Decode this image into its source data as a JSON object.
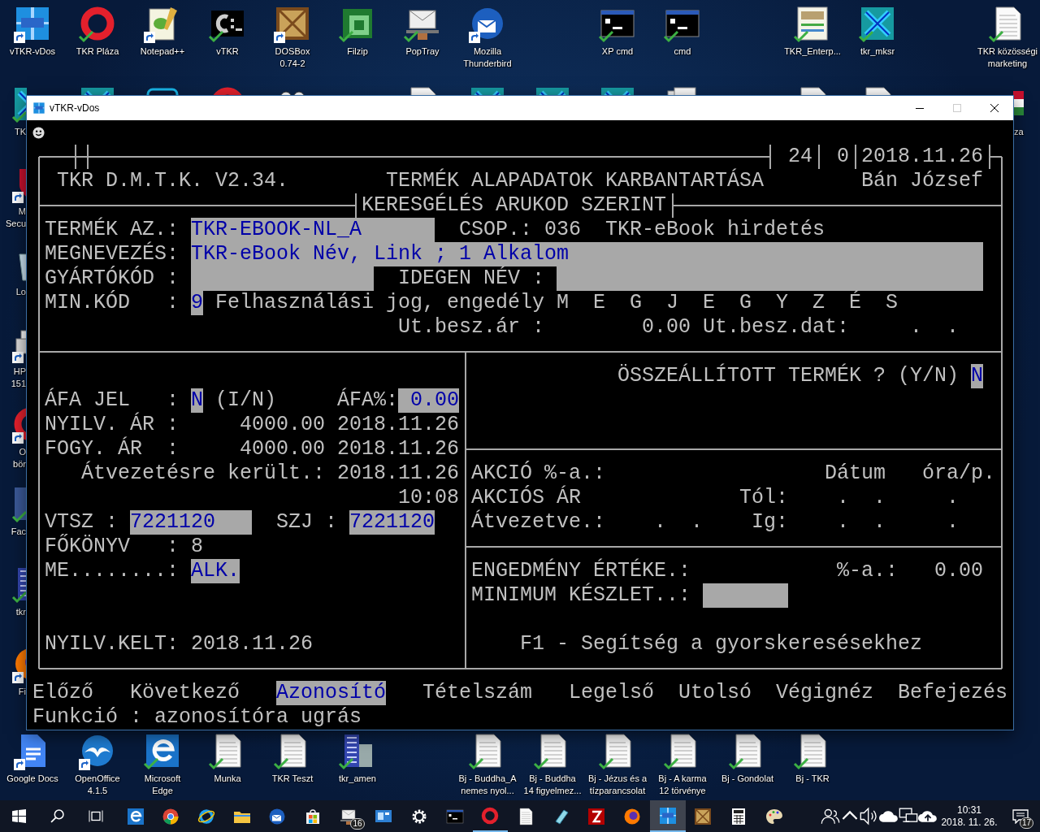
{
  "top_row_icons": [
    {
      "label": "vTKR-vDos",
      "kind": "dos",
      "shortcut": true,
      "synced": false
    },
    {
      "label": "TKR Pláza",
      "kind": "opera",
      "shortcut": false,
      "synced": true
    },
    {
      "label": "Notepad++",
      "kind": "notepad",
      "shortcut": true,
      "synced": false
    },
    {
      "label": "vTKR",
      "kind": "console",
      "shortcut": false,
      "synced": true
    },
    {
      "label": "DOSBox\n0.74-2",
      "kind": "dosbox",
      "shortcut": true,
      "synced": false
    },
    {
      "label": "Filzip",
      "kind": "filzip",
      "shortcut": false,
      "synced": true
    },
    {
      "label": "PopTray",
      "kind": "mail",
      "shortcut": false,
      "synced": true
    },
    {
      "label": "Mozilla\nThunderbird",
      "kind": "thunderbird",
      "shortcut": true,
      "synced": false
    },
    {
      "label": "XP cmd",
      "kind": "cmd",
      "shortcut": false,
      "synced": true
    },
    {
      "label": "cmd",
      "kind": "cmd",
      "shortcut": false,
      "synced": true
    },
    {
      "label": "TKR_Enterp...",
      "kind": "screenshot",
      "shortcut": false,
      "synced": true
    },
    {
      "label": "tkr_mksr",
      "kind": "tkr",
      "shortcut": false,
      "synced": true
    },
    {
      "label": "TKR közösségi\nmarketing",
      "kind": "document",
      "shortcut": false,
      "synced": true
    }
  ],
  "covered_icons": [
    {
      "kind": "tkr"
    },
    {
      "kind": "app"
    },
    {
      "kind": "opera"
    },
    {
      "kind": "eyes"
    },
    {
      "kind": "pdf"
    },
    {
      "kind": "tkr"
    },
    {
      "kind": "tkr"
    },
    {
      "kind": "tkr"
    },
    {
      "kind": "docstack"
    },
    {
      "kind": "document"
    },
    {
      "kind": "document"
    }
  ],
  "left_edge_icons": [
    {
      "label": "TK",
      "kind": "tkr",
      "shortcut": false,
      "synced": true
    },
    {
      "label": "M\nSecu",
      "kind": "shield",
      "shortcut": true,
      "synced": false
    },
    {
      "label": "Lo",
      "kind": "recycle",
      "shortcut": false,
      "synced": false
    },
    {
      "label": "HP\n151",
      "kind": "printer",
      "shortcut": true,
      "synced": false
    },
    {
      "label": "O\nbör",
      "kind": "opera",
      "shortcut": true,
      "synced": false
    },
    {
      "label": "Fac",
      "kind": "facebook",
      "shortcut": false,
      "synced": true
    },
    {
      "label": "tkr",
      "kind": "building",
      "shortcut": false,
      "synced": true
    },
    {
      "label": "Fi",
      "kind": "firefox",
      "shortcut": true,
      "synced": false
    }
  ],
  "right_edge_icons": [
    {
      "label": "za",
      "kind": "flag"
    }
  ],
  "bottom_row_icons": [
    {
      "label": "Google Docs",
      "kind": "gdocs",
      "shortcut": true,
      "synced": false
    },
    {
      "label": "OpenOffice\n4.1.5",
      "kind": "openoffice",
      "shortcut": true,
      "synced": false
    },
    {
      "label": "Microsoft\nEdge",
      "kind": "edge",
      "shortcut": false,
      "synced": true
    },
    {
      "label": "Munka",
      "kind": "document",
      "shortcut": false,
      "synced": true
    },
    {
      "label": "TKR Teszt",
      "kind": "document",
      "shortcut": false,
      "synced": true
    },
    {
      "label": "tkr_amen",
      "kind": "building",
      "shortcut": false,
      "synced": true
    },
    {
      "label": "Bj - Buddha_A\nnemes nyol...",
      "kind": "document",
      "shortcut": false,
      "synced": true
    },
    {
      "label": "Bj - Buddha\n14 figyelmez...",
      "kind": "document",
      "shortcut": false,
      "synced": true
    },
    {
      "label": "Bj - Jézus és a\ntízparancsolat",
      "kind": "document",
      "shortcut": false,
      "synced": true
    },
    {
      "label": "Bj - A karma\n12 törvénye",
      "kind": "document",
      "shortcut": false,
      "synced": true
    },
    {
      "label": "Bj - Gondolat",
      "kind": "document",
      "shortcut": false,
      "synced": true
    },
    {
      "label": "Bj - TKR",
      "kind": "document",
      "shortcut": false,
      "synced": true
    }
  ],
  "window": {
    "title": "vTKR-vDos",
    "maximize_disabled": true
  },
  "screen": {
    "cells": [
      {
        "text": "24",
        "kind": "value"
      },
      {
        "text": "0",
        "kind": "value"
      },
      {
        "text": "2018.11.26",
        "kind": "value"
      },
      {
        "text": "TKR D.M.T.K. V2.34.",
        "kind": "title"
      },
      {
        "text": "TERMÉK ALAPADATOK KARBANTARTÁSA",
        "kind": "title"
      },
      {
        "text": "Bán József",
        "kind": "value"
      },
      {
        "text": "KERESGÉLÉS ARUKOD SZERINT",
        "kind": "title"
      },
      {
        "text": "TERMÉK AZ.:",
        "kind": "label"
      },
      {
        "text": "TKR-EBOOK-NL_A",
        "kind": "field"
      },
      {
        "text": "CSOP.:",
        "kind": "label"
      },
      {
        "text": "036",
        "kind": "value"
      },
      {
        "text": "TKR-eBook hirdetés",
        "kind": "value"
      },
      {
        "text": "MEGNEVEZÉS:",
        "kind": "label"
      },
      {
        "text": "TKR-eBook Név, Link ; 1 Alkalom",
        "kind": "field"
      },
      {
        "text": "GYÁRTÓKÓD :",
        "kind": "label"
      },
      {
        "kind": "field"
      },
      {
        "text": "IDEGEN NÉV :",
        "kind": "label"
      },
      {
        "kind": "field"
      },
      {
        "text": "MIN.KÓD   :",
        "kind": "label"
      },
      {
        "text": "9",
        "kind": "field"
      },
      {
        "text": "Felhasználási jog, engedély",
        "kind": "value"
      },
      {
        "text": "M  E  G  J  E  G  Y  Z  É  S",
        "kind": "label"
      },
      {
        "text": "Ut.besz.ár :",
        "kind": "label"
      },
      {
        "text": "0.00",
        "kind": "value"
      },
      {
        "text": "Ut.besz.dat:",
        "kind": "label"
      },
      {
        "text": ".  .",
        "kind": "value"
      },
      {
        "text": "ÖSSZEÁLLÍTOTT TERMÉK ? (Y/N)",
        "kind": "label"
      },
      {
        "text": "N",
        "kind": "field"
      },
      {
        "text": "ÁFA JEL   :",
        "kind": "label"
      },
      {
        "text": "N",
        "kind": "field"
      },
      {
        "text": "(I/N)",
        "kind": "label"
      },
      {
        "text": "ÁFA%:",
        "kind": "label"
      },
      {
        "text": "0.00",
        "kind": "field"
      },
      {
        "text": "NYILV. ÁR :",
        "kind": "label"
      },
      {
        "text": "4000.00",
        "kind": "value"
      },
      {
        "text": "2018.11.26",
        "kind": "value"
      },
      {
        "text": "FOGY. ÁR  :",
        "kind": "label"
      },
      {
        "text": "4000.00",
        "kind": "value"
      },
      {
        "text": "2018.11.26",
        "kind": "value"
      },
      {
        "text": "Átvezetésre került.:",
        "kind": "label"
      },
      {
        "text": "2018.11.26",
        "kind": "value"
      },
      {
        "text": "AKCIÓ %-a.:",
        "kind": "label"
      },
      {
        "text": "Dátum",
        "kind": "label"
      },
      {
        "text": "óra/p.",
        "kind": "label"
      },
      {
        "text": "10:08",
        "kind": "value"
      },
      {
        "text": "AKCIÓS ÁR",
        "kind": "label"
      },
      {
        "text": "Tól:",
        "kind": "label"
      },
      {
        "text": ".  .",
        "kind": "value"
      },
      {
        "text": ".",
        "kind": "value"
      },
      {
        "text": "VTSZ :",
        "kind": "label"
      },
      {
        "text": "7221120",
        "kind": "field"
      },
      {
        "text": "SZJ :",
        "kind": "label"
      },
      {
        "text": "7221120",
        "kind": "field"
      },
      {
        "text": "Átvezetve.:",
        "kind": "label"
      },
      {
        "text": ".  .",
        "kind": "value"
      },
      {
        "text": "Ig:",
        "kind": "label"
      },
      {
        "text": ".  .",
        "kind": "value"
      },
      {
        "text": ".",
        "kind": "value"
      },
      {
        "text": "FŐKÖNYV   :",
        "kind": "label"
      },
      {
        "text": "8",
        "kind": "value"
      },
      {
        "text": "ME........:",
        "kind": "label"
      },
      {
        "text": "ALK.",
        "kind": "field"
      },
      {
        "text": "ENGEDMÉNY ÉRTÉKE.:",
        "kind": "label"
      },
      {
        "text": "%-a.:",
        "kind": "label"
      },
      {
        "text": "0.00",
        "kind": "value"
      },
      {
        "text": "MINIMUM KÉSZLET..:",
        "kind": "label"
      },
      {
        "kind": "field"
      },
      {
        "text": "NYILV.KELT:",
        "kind": "label"
      },
      {
        "text": "2018.11.26",
        "kind": "value"
      },
      {
        "text": "F1 - Segítség a gyorskeresésekhez",
        "kind": "hint"
      }
    ],
    "menu": [
      {
        "label": "Előző",
        "selected": false
      },
      {
        "label": "Következő",
        "selected": false
      },
      {
        "label": "Azonosító",
        "selected": true
      },
      {
        "label": "Tételszám",
        "selected": false
      },
      {
        "label": "Legelső",
        "selected": false
      },
      {
        "label": "Utolsó",
        "selected": false
      },
      {
        "label": "Végignéz",
        "selected": false
      },
      {
        "label": "Befejezés",
        "selected": false
      }
    ],
    "status": "Funkció : azonosítóra ugrás"
  },
  "taskbar": {
    "apps": [
      {
        "kind": "edge",
        "open": false,
        "selected": false
      },
      {
        "kind": "chrome",
        "open": false,
        "selected": false
      },
      {
        "kind": "ie",
        "open": false,
        "selected": false
      },
      {
        "kind": "explorer",
        "open": false,
        "selected": false
      },
      {
        "kind": "thunderbird",
        "open": false,
        "selected": false
      },
      {
        "kind": "store",
        "open": false,
        "selected": false
      },
      {
        "kind": "mail",
        "open": false,
        "selected": false,
        "badge": "16"
      },
      {
        "kind": "controlpanel",
        "open": false,
        "selected": false
      },
      {
        "kind": "settings",
        "open": false,
        "selected": false
      },
      {
        "kind": "cmd",
        "open": false,
        "selected": false
      },
      {
        "kind": "opera",
        "open": true,
        "selected": false
      },
      {
        "kind": "document",
        "open": false,
        "selected": false
      },
      {
        "kind": "pen",
        "open": false,
        "selected": false
      },
      {
        "kind": "filezilla",
        "open": false,
        "selected": false
      },
      {
        "kind": "firefox",
        "open": false,
        "selected": false
      },
      {
        "kind": "dos",
        "open": true,
        "selected": true
      },
      {
        "kind": "dosbox",
        "open": false,
        "selected": false
      },
      {
        "kind": "calculator",
        "open": false,
        "selected": false
      },
      {
        "kind": "paint",
        "open": false,
        "selected": false
      }
    ],
    "time": "10:31",
    "date": "2018. 11. 26.",
    "notifications": "17"
  }
}
